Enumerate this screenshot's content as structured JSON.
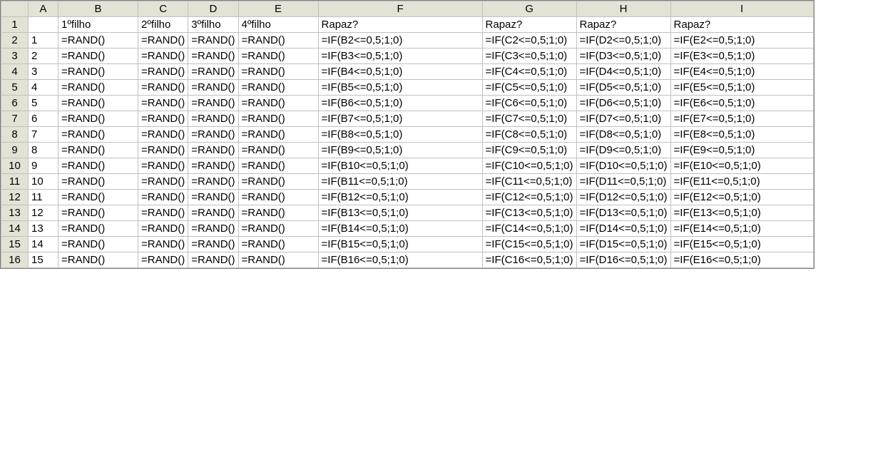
{
  "columns": [
    "A",
    "B",
    "C",
    "D",
    "E",
    "F",
    "G",
    "H",
    "I"
  ],
  "header_row": {
    "num": "1",
    "cells": {
      "A": "",
      "B": "1ºfilho",
      "C": "2ºfilho",
      "D": "3ºfilho",
      "E": "4ºfilho",
      "F": "Rapaz?",
      "G": "Rapaz?",
      "H": "Rapaz?",
      "I": "Rapaz?"
    }
  },
  "rows": [
    {
      "num": "2",
      "cells": {
        "A": "1",
        "B": "=RAND()",
        "C": "=RAND()",
        "D": "=RAND()",
        "E": "=RAND()",
        "F": "=IF(B2<=0,5;1;0)",
        "G": "=IF(C2<=0,5;1;0)",
        "H": "=IF(D2<=0,5;1;0)",
        "I": "=IF(E2<=0,5;1;0)"
      }
    },
    {
      "num": "3",
      "cells": {
        "A": "2",
        "B": "=RAND()",
        "C": "=RAND()",
        "D": "=RAND()",
        "E": "=RAND()",
        "F": "=IF(B3<=0,5;1;0)",
        "G": "=IF(C3<=0,5;1;0)",
        "H": "=IF(D3<=0,5;1;0)",
        "I": "=IF(E3<=0,5;1;0)"
      }
    },
    {
      "num": "4",
      "cells": {
        "A": "3",
        "B": "=RAND()",
        "C": "=RAND()",
        "D": "=RAND()",
        "E": "=RAND()",
        "F": "=IF(B4<=0,5;1;0)",
        "G": "=IF(C4<=0,5;1;0)",
        "H": "=IF(D4<=0,5;1;0)",
        "I": "=IF(E4<=0,5;1;0)"
      }
    },
    {
      "num": "5",
      "cells": {
        "A": "4",
        "B": "=RAND()",
        "C": "=RAND()",
        "D": "=RAND()",
        "E": "=RAND()",
        "F": "=IF(B5<=0,5;1;0)",
        "G": "=IF(C5<=0,5;1;0)",
        "H": "=IF(D5<=0,5;1;0)",
        "I": "=IF(E5<=0,5;1;0)"
      }
    },
    {
      "num": "6",
      "cells": {
        "A": "5",
        "B": "=RAND()",
        "C": "=RAND()",
        "D": "=RAND()",
        "E": "=RAND()",
        "F": "=IF(B6<=0,5;1;0)",
        "G": "=IF(C6<=0,5;1;0)",
        "H": "=IF(D6<=0,5;1;0)",
        "I": "=IF(E6<=0,5;1;0)"
      }
    },
    {
      "num": "7",
      "cells": {
        "A": "6",
        "B": "=RAND()",
        "C": "=RAND()",
        "D": "=RAND()",
        "E": "=RAND()",
        "F": "=IF(B7<=0,5;1;0)",
        "G": "=IF(C7<=0,5;1;0)",
        "H": "=IF(D7<=0,5;1;0)",
        "I": "=IF(E7<=0,5;1;0)"
      }
    },
    {
      "num": "8",
      "cells": {
        "A": "7",
        "B": "=RAND()",
        "C": "=RAND()",
        "D": "=RAND()",
        "E": "=RAND()",
        "F": "=IF(B8<=0,5;1;0)",
        "G": "=IF(C8<=0,5;1;0)",
        "H": "=IF(D8<=0,5;1;0)",
        "I": "=IF(E8<=0,5;1;0)"
      }
    },
    {
      "num": "9",
      "cells": {
        "A": "8",
        "B": "=RAND()",
        "C": "=RAND()",
        "D": "=RAND()",
        "E": "=RAND()",
        "F": "=IF(B9<=0,5;1;0)",
        "G": "=IF(C9<=0,5;1;0)",
        "H": "=IF(D9<=0,5;1;0)",
        "I": "=IF(E9<=0,5;1;0)"
      }
    },
    {
      "num": "10",
      "cells": {
        "A": "9",
        "B": "=RAND()",
        "C": "=RAND()",
        "D": "=RAND()",
        "E": "=RAND()",
        "F": "=IF(B10<=0,5;1;0)",
        "G": "=IF(C10<=0,5;1;0)",
        "H": "=IF(D10<=0,5;1;0)",
        "I": "=IF(E10<=0,5;1;0)"
      }
    },
    {
      "num": "11",
      "cells": {
        "A": "10",
        "B": "=RAND()",
        "C": "=RAND()",
        "D": "=RAND()",
        "E": "=RAND()",
        "F": "=IF(B11<=0,5;1;0)",
        "G": "=IF(C11<=0,5;1;0)",
        "H": "=IF(D11<=0,5;1;0)",
        "I": "=IF(E11<=0,5;1;0)"
      }
    },
    {
      "num": "12",
      "cells": {
        "A": "11",
        "B": "=RAND()",
        "C": "=RAND()",
        "D": "=RAND()",
        "E": "=RAND()",
        "F": "=IF(B12<=0,5;1;0)",
        "G": "=IF(C12<=0,5;1;0)",
        "H": "=IF(D12<=0,5;1;0)",
        "I": "=IF(E12<=0,5;1;0)"
      }
    },
    {
      "num": "13",
      "cells": {
        "A": "12",
        "B": "=RAND()",
        "C": "=RAND()",
        "D": "=RAND()",
        "E": "=RAND()",
        "F": "=IF(B13<=0,5;1;0)",
        "G": "=IF(C13<=0,5;1;0)",
        "H": "=IF(D13<=0,5;1;0)",
        "I": "=IF(E13<=0,5;1;0)"
      }
    },
    {
      "num": "14",
      "cells": {
        "A": "13",
        "B": "=RAND()",
        "C": "=RAND()",
        "D": "=RAND()",
        "E": "=RAND()",
        "F": "=IF(B14<=0,5;1;0)",
        "G": "=IF(C14<=0,5;1;0)",
        "H": "=IF(D14<=0,5;1;0)",
        "I": "=IF(E14<=0,5;1;0)"
      }
    },
    {
      "num": "15",
      "cells": {
        "A": "14",
        "B": "=RAND()",
        "C": "=RAND()",
        "D": "=RAND()",
        "E": "=RAND()",
        "F": "=IF(B15<=0,5;1;0)",
        "G": "=IF(C15<=0,5;1;0)",
        "H": "=IF(D15<=0,5;1;0)",
        "I": "=IF(E15<=0,5;1;0)"
      }
    },
    {
      "num": "16",
      "cells": {
        "A": "15",
        "B": "=RAND()",
        "C": "=RAND()",
        "D": "=RAND()",
        "E": "=RAND()",
        "F": "=IF(B16<=0,5;1;0)",
        "G": "=IF(C16<=0,5;1;0)",
        "H": "=IF(D16<=0,5;1;0)",
        "I": "=IF(E16<=0,5;1;0)"
      }
    }
  ]
}
